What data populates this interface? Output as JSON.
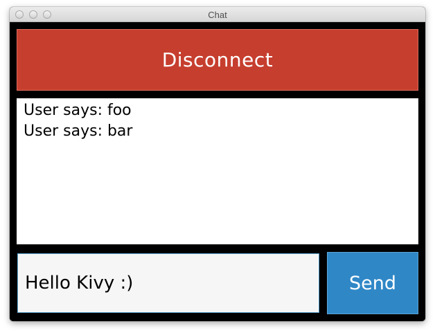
{
  "window": {
    "title": "Chat"
  },
  "header": {
    "disconnect_label": "Disconnect"
  },
  "chat_log": {
    "lines": [
      "User says: foo",
      "User says: bar"
    ]
  },
  "composer": {
    "input_value": "Hello Kivy :)",
    "send_label": "Send"
  },
  "colors": {
    "disconnect_bg": "#c63e2e",
    "send_bg": "#2f87c6",
    "input_border": "#5fa8d3",
    "window_bg": "#000000"
  }
}
